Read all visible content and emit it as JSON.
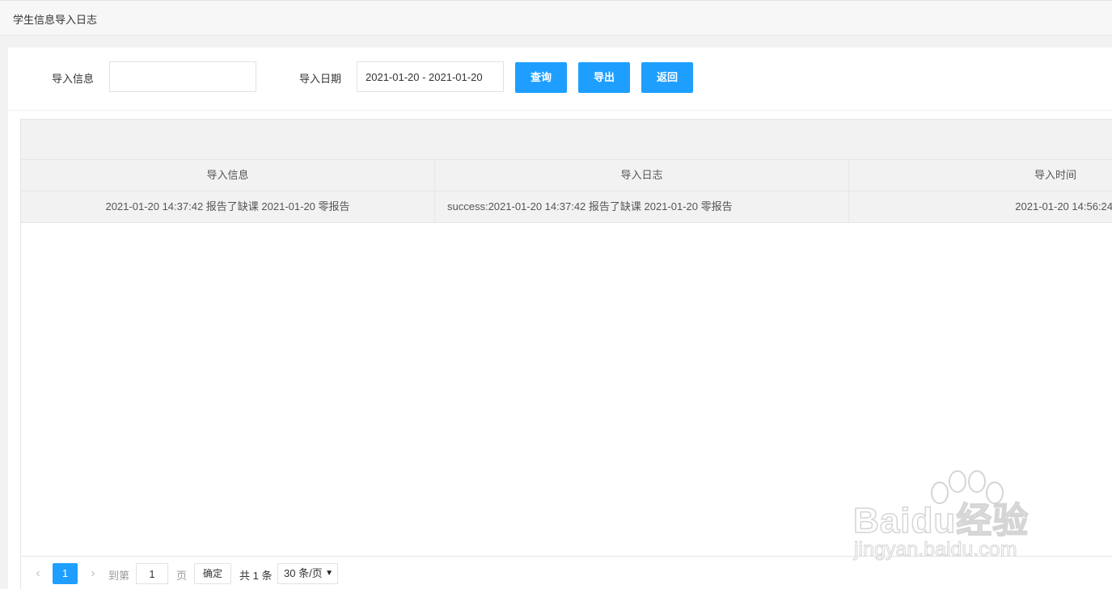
{
  "header": {
    "title": "学生信息导入日志"
  },
  "filters": {
    "info_label": "导入信息",
    "info_value": "",
    "date_label": "导入日期",
    "date_value": "2021-01-20 - 2021-01-20"
  },
  "buttons": {
    "query": "查询",
    "export": "导出",
    "back": "返回"
  },
  "table": {
    "columns": [
      "导入信息",
      "导入日志",
      "导入时间"
    ],
    "rows": [
      {
        "info": "2021-01-20 14:37:42 报告了缺课 2021-01-20 零报告",
        "log": "success:2021-01-20 14:37:42 报告了缺课 2021-01-20 零报告",
        "time": "2021-01-20 14:56:24"
      }
    ]
  },
  "pagination": {
    "current_page": "1",
    "goto_prefix": "到第",
    "goto_value": "1",
    "goto_suffix": "页",
    "confirm": "确定",
    "total": "共 1 条",
    "page_size": "30 条/页",
    "prev_icon": "chevron-left-icon",
    "next_icon": "chevron-right-icon"
  },
  "colors": {
    "accent": "#1e9fff",
    "header_bg": "#f2f2f2"
  },
  "watermark": {
    "brand": "Baidu经验",
    "url": "jingyan.baidu.com"
  }
}
